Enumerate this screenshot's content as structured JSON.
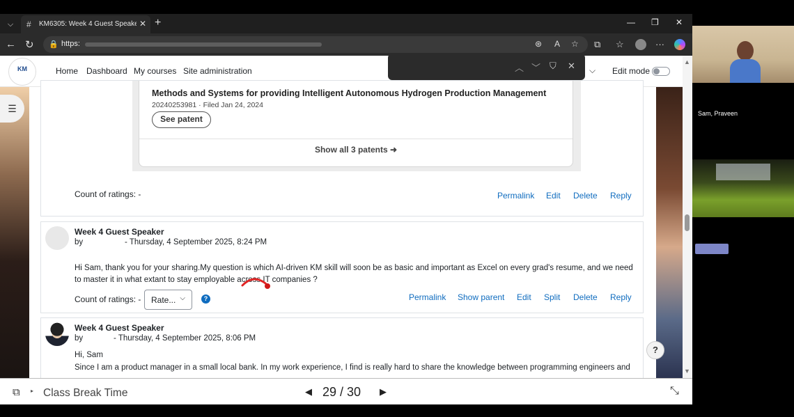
{
  "browser": {
    "tab_title": "KM6305: Week 4 Guest Speaker |",
    "url_prefix": "https:",
    "find_icons": {
      "up": "chevron-up-icon",
      "down": "chevron-down-icon",
      "filter": "filter-icon",
      "close": "close-icon"
    }
  },
  "navbar": {
    "logo_text": "KM",
    "links": [
      "Home",
      "Dashboard",
      "My courses",
      "Site administration"
    ],
    "edit_mode_label": "Edit mode",
    "edit_mode_on": false
  },
  "patent": {
    "title": "Methods and Systems for providing Intelligent Autonomous Hydrogen Production Management",
    "meta": "20240253981 · Filed Jan 24, 2024",
    "see_button": "See patent",
    "show_all": "Show all 3 patents ➜"
  },
  "post1": {
    "rating_label": "Count of ratings: -",
    "actions": [
      "Permalink",
      "Edit",
      "Delete",
      "Reply"
    ]
  },
  "post2": {
    "subject": "Week 4 Guest Speaker",
    "by": "by",
    "date": "- Thursday, 4 September 2025, 8:24 PM",
    "body": "Hi Sam, thank you for your sharing.My question is which AI-driven KM skill will soon be as basic and important as Excel on every grad's resume, and we need to master it in what extant to stay employable across IT companies ?",
    "rating_label": "Count of ratings: -",
    "rate_select": "Rate...",
    "help": "?",
    "actions": [
      "Permalink",
      "Show parent",
      "Edit",
      "Split",
      "Delete",
      "Reply"
    ]
  },
  "post3": {
    "subject": "Week 4 Guest Speaker",
    "by": "by",
    "date": "- Thursday, 4 September 2025, 8:06 PM",
    "greeting": "Hi, Sam",
    "body": "Since I am a product manager in a small local bank. In my work experience, I find is really hard to share the knowledge between programming engineers and"
  },
  "help_fab": "?",
  "presentation": {
    "title": "Class Break Time",
    "page": "29 / 30"
  },
  "meeting": {
    "participant_name": "Sam, Praveen"
  },
  "colors": {
    "link": "#0f6cbf",
    "text": "#1d2125",
    "border": "#dee2e6"
  }
}
